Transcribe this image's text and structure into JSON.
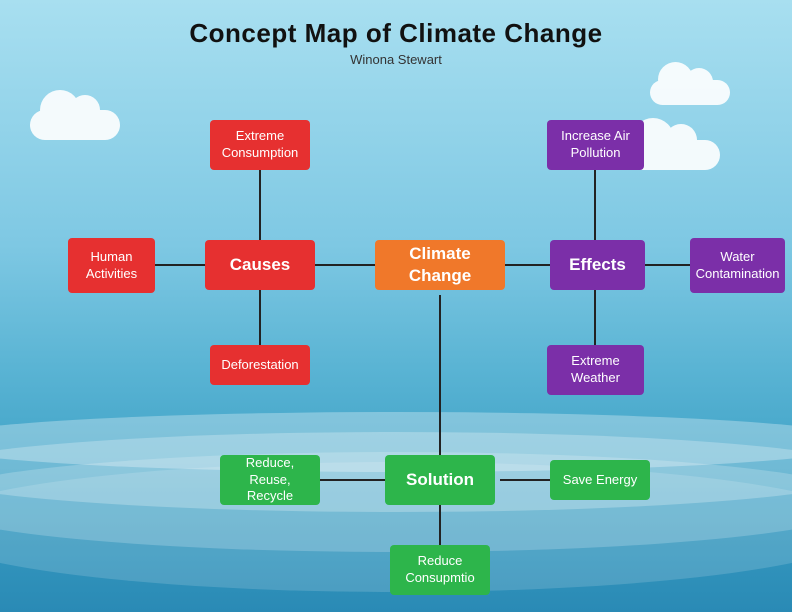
{
  "page": {
    "title": "Concept Map of Climate Change",
    "subtitle": "Winona Stewart"
  },
  "boxes": {
    "extreme_consumption": {
      "label": "Extreme\nConsumption",
      "color": "red"
    },
    "deforestation": {
      "label": "Deforestation",
      "color": "red"
    },
    "human_activities": {
      "label": "Human\nActivities",
      "color": "red"
    },
    "causes": {
      "label": "Causes",
      "color": "red",
      "bold": true
    },
    "climate_change": {
      "label": "Climate Change",
      "color": "orange",
      "bold": true
    },
    "effects": {
      "label": "Effects",
      "color": "purple",
      "bold": true
    },
    "increase_air": {
      "label": "Increase Air\nPollution",
      "color": "purple"
    },
    "extreme_weather": {
      "label": "Extreme\nWeather",
      "color": "purple"
    },
    "water_contamination": {
      "label": "Water\nContamination",
      "color": "purple"
    },
    "solution": {
      "label": "Solution",
      "color": "green",
      "bold": true
    },
    "reduce_reuse": {
      "label": "Reduce, Reuse,\nRecycle",
      "color": "green"
    },
    "save_energy": {
      "label": "Save Energy",
      "color": "green"
    },
    "reduce_consumption": {
      "label": "Reduce\nConsupmtio",
      "color": "green"
    }
  }
}
